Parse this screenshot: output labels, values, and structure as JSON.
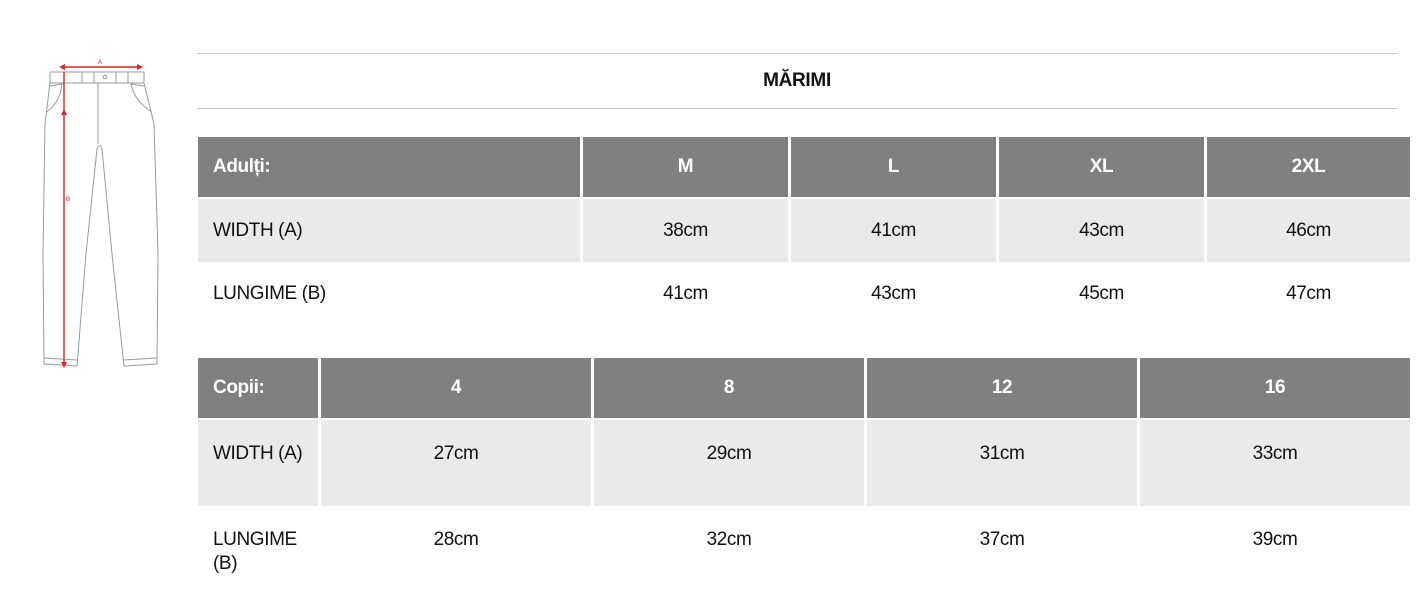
{
  "illustration": {
    "label_a": "A",
    "label_b": "B",
    "measure_color": "#d8232a"
  },
  "title": "MĂRIMI",
  "adults": {
    "header": "Adulți:",
    "sizes": [
      "M",
      "L",
      "XL",
      "2XL"
    ],
    "rows": [
      {
        "label": "WIDTH (A)",
        "values": [
          "38cm",
          "41cm",
          "43cm",
          "46cm"
        ]
      },
      {
        "label": "LUNGIME (B)",
        "values": [
          "41cm",
          "43cm",
          "45cm",
          "47cm"
        ]
      }
    ]
  },
  "children": {
    "header": "Copii:",
    "sizes": [
      "4",
      "8",
      "12",
      "16"
    ],
    "rows": [
      {
        "label": "WIDTH (A)",
        "values": [
          "27cm",
          "29cm",
          "31cm",
          "33cm"
        ]
      },
      {
        "label": "LUNGIME (B)",
        "values": [
          "28cm",
          "32cm",
          "37cm",
          "39cm"
        ]
      }
    ]
  },
  "colors": {
    "header_bg": "#808080",
    "row_shade": "#eaeaea",
    "rule": "#c8c8c8"
  }
}
